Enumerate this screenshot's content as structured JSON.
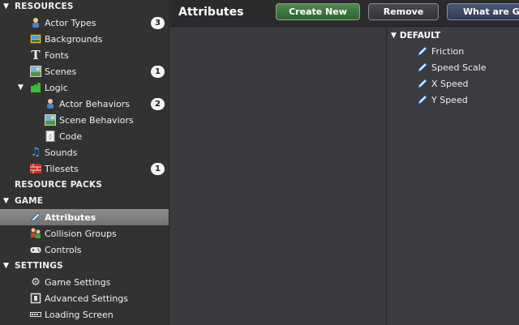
{
  "sidebar": {
    "resources": {
      "label": "RESOURCES"
    },
    "actor_types": {
      "label": "Actor Types",
      "badge": "3"
    },
    "backgrounds": {
      "label": "Backgrounds"
    },
    "fonts": {
      "label": "Fonts"
    },
    "scenes": {
      "label": "Scenes",
      "badge": "1"
    },
    "logic": {
      "label": "Logic"
    },
    "actor_behaviors": {
      "label": "Actor Behaviors",
      "badge": "2"
    },
    "scene_behaviors": {
      "label": "Scene Behaviors"
    },
    "code": {
      "label": "Code"
    },
    "sounds": {
      "label": "Sounds"
    },
    "tilesets": {
      "label": "Tilesets",
      "badge": "1"
    },
    "resource_packs": {
      "label": "RESOURCE PACKS"
    },
    "game": {
      "label": "GAME"
    },
    "attributes": {
      "label": "Attributes"
    },
    "collision_groups": {
      "label": "Collision Groups"
    },
    "controls": {
      "label": "Controls"
    },
    "settings": {
      "label": "SETTINGS"
    },
    "game_settings": {
      "label": "Game Settings"
    },
    "advanced_settings": {
      "label": "Advanced Settings"
    },
    "loading_screen": {
      "label": "Loading Screen"
    }
  },
  "header": {
    "title": "Attributes",
    "create_label": "Create New",
    "remove_label": "Remove",
    "what_label": "What are Ga"
  },
  "attributes_panel": {
    "group_label": "DEFAULT",
    "items": [
      "Friction",
      "Speed Scale",
      "X Speed",
      "Y Speed"
    ]
  },
  "colors": {
    "selected_row": "#808080",
    "create_button": "#3d7a3d",
    "what_button": "#3f4c6b",
    "badge": "#f4f4f4"
  }
}
